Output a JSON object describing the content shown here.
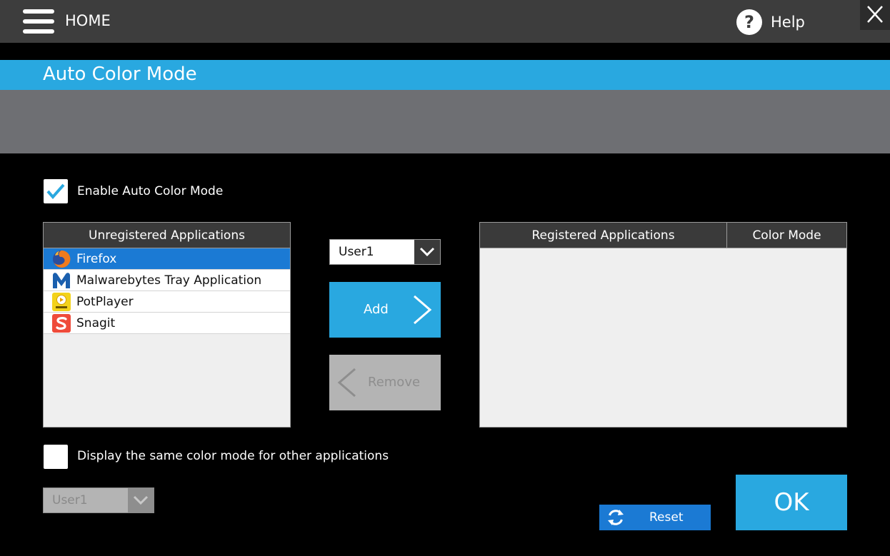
{
  "header": {
    "home_label": "HOME",
    "help_icon_glyph": "?",
    "help_label": "Help"
  },
  "title": "Auto Color Mode",
  "enable_checkbox": {
    "label": "Enable Auto Color Mode",
    "checked": true
  },
  "unregistered": {
    "header": "Unregistered Applications",
    "items": [
      {
        "name": "Firefox",
        "icon": "firefox-icon",
        "selected": true
      },
      {
        "name": "Malwarebytes Tray Application",
        "icon": "malwarebytes-icon",
        "selected": false
      },
      {
        "name": "PotPlayer",
        "icon": "potplayer-icon",
        "selected": false
      },
      {
        "name": "Snagit",
        "icon": "snagit-icon",
        "selected": false
      }
    ]
  },
  "mode_dropdown": {
    "value": "User1"
  },
  "add_button": {
    "label": "Add"
  },
  "remove_button": {
    "label": "Remove"
  },
  "registered": {
    "col_applications": "Registered Applications",
    "col_color_mode": "Color Mode",
    "items": []
  },
  "same_mode_checkbox": {
    "label": "Display the same color mode for other applications",
    "checked": false
  },
  "other_mode_dropdown": {
    "value": "User1"
  },
  "reset_button": {
    "label": "Reset"
  },
  "ok_button": {
    "label": "OK"
  },
  "colors": {
    "accent": "#29a8e0",
    "selection": "#1b7ad4",
    "topbar": "#3d3d3d",
    "band": "#6e6f73"
  }
}
